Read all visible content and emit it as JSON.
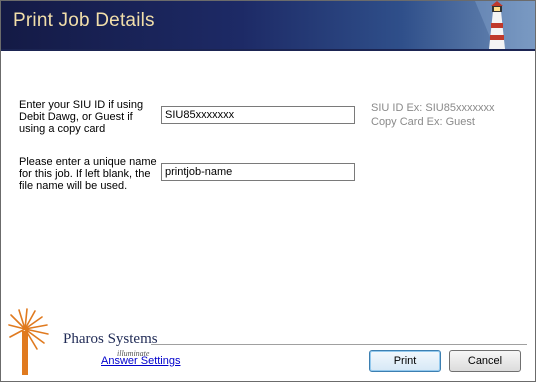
{
  "window": {
    "title": "Print Job Details"
  },
  "form": {
    "siu_label": "Enter your SIU ID if using Debit Dawg, or Guest if using a copy card",
    "siu_value": "SIU85xxxxxxx",
    "siu_hint_line1": "SIU ID Ex: SIU85xxxxxxx",
    "siu_hint_line2": "Copy Card Ex: Guest",
    "jobname_label": "Please enter a unique name for this job. If left blank, the file name will be used.",
    "jobname_value": "printjob-name"
  },
  "footer": {
    "brand": "Pharos Systems",
    "brand_sub": "illuminate",
    "answer_settings_link": "Answer Settings",
    "print_button": "Print",
    "cancel_button": "Cancel"
  },
  "colors": {
    "header_dark": "#141a45",
    "title_text": "#f2dfaa",
    "link": "#0000cc",
    "logo_orange": "#e07a1f"
  },
  "icons": {
    "header": "lighthouse-icon",
    "logo": "pharos-logo-icon"
  }
}
